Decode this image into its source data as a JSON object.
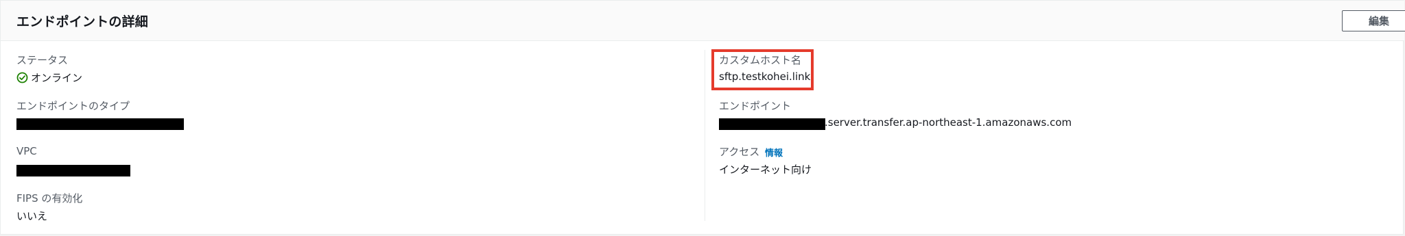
{
  "panel": {
    "title": "エンドポイントの詳細",
    "edit_label": "編集"
  },
  "left": {
    "status": {
      "label": "ステータス",
      "value": "オンライン",
      "icon": "check-circle-icon",
      "color": "#1d8102"
    },
    "endpoint_type": {
      "label": "エンドポイントのタイプ"
    },
    "vpc": {
      "label": "VPC"
    },
    "fips": {
      "label": "FIPS の有効化",
      "value": "いいえ"
    }
  },
  "right": {
    "custom_host": {
      "label": "カスタムホスト名",
      "value": "sftp.testkohei.link",
      "highlight_color": "#e53b2c"
    },
    "endpoint": {
      "label": "エンドポイント",
      "value_suffix": ".server.transfer.ap-northeast-1.amazonaws.com"
    },
    "access": {
      "label": "アクセス",
      "info_label": "情報",
      "value": "インターネット向け"
    }
  },
  "colors": {
    "link": "#0073bb",
    "label": "#545b64",
    "text": "#16191f",
    "redaction": "#000000"
  }
}
